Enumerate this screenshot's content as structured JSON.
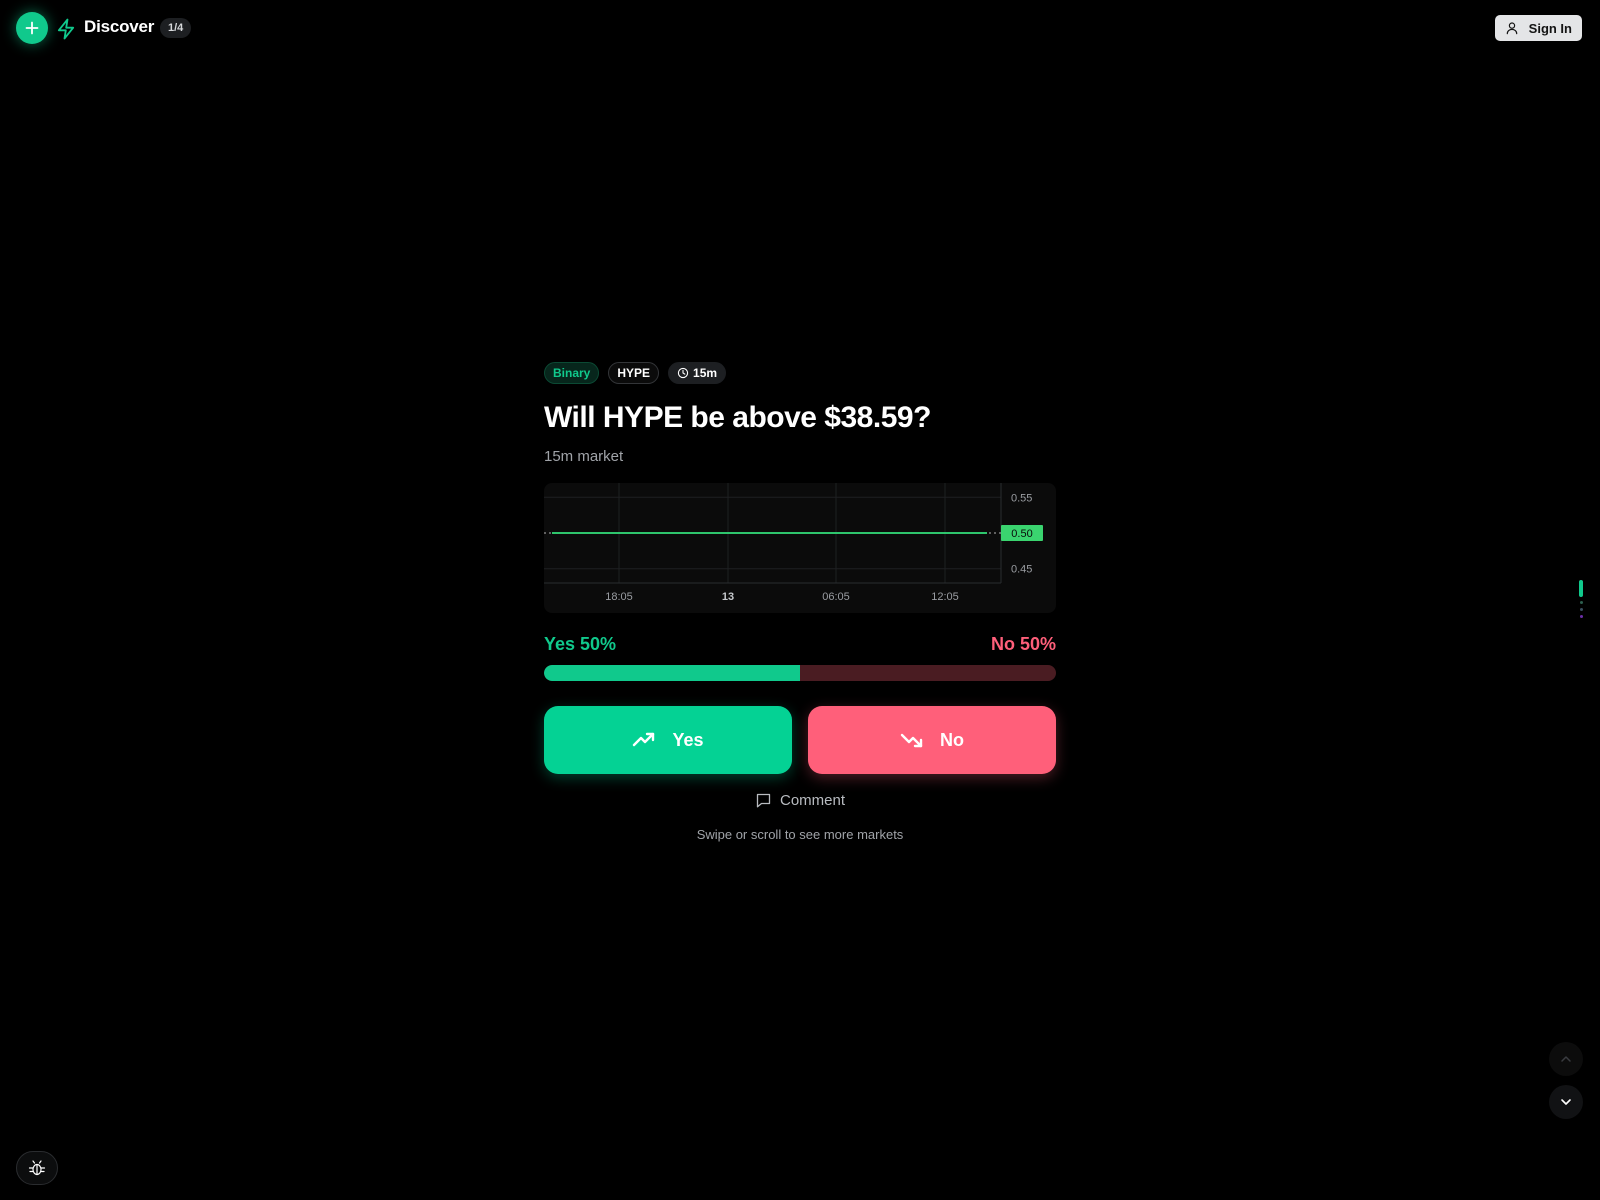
{
  "header": {
    "title": "Discover",
    "counter": "1/4",
    "sign_in_label": "Sign In",
    "icons": {
      "add": "plus-icon",
      "brand": "bolt-icon",
      "user": "user-icon"
    }
  },
  "market": {
    "tags": {
      "type": "Binary",
      "asset": "HYPE",
      "timeframe": "15m"
    },
    "question": "Will HYPE be above $38.59?",
    "subtitle": "15m market",
    "odds": {
      "yes_label": "Yes 50%",
      "no_label": "No 50%",
      "yes_fraction": 0.5
    },
    "buttons": {
      "yes": "Yes",
      "no": "No"
    },
    "comment_label": "Comment",
    "hint": "Swipe or scroll to see more markets"
  },
  "chart_data": {
    "type": "line",
    "x_ticks": [
      "18:05",
      "13",
      "06:05",
      "12:05"
    ],
    "y_ticks": [
      0.55,
      0.45
    ],
    "ylim": [
      0.43,
      0.57
    ],
    "current_value": 0.5,
    "current_label": "0.50",
    "series": [
      {
        "values": [
          0.5,
          0.5,
          0.5,
          0.5,
          0.5,
          0.5,
          0.5,
          0.5,
          0.5,
          0.5,
          0.5,
          0.5,
          0.5,
          0.5,
          0.5,
          0.5,
          0.5,
          0.5,
          0.5,
          0.5,
          0.5,
          0.5,
          0.5,
          0.5,
          0.5,
          0.5,
          0.5,
          0.5,
          0.5,
          0.5
        ]
      }
    ],
    "grid": true
  },
  "pager": {
    "total": 4,
    "active": 1
  },
  "colors": {
    "accent": "#10c98c",
    "yes": "#04d294",
    "no": "#ff5f7a",
    "chart_line": "#33e07a",
    "background": "#000000"
  }
}
